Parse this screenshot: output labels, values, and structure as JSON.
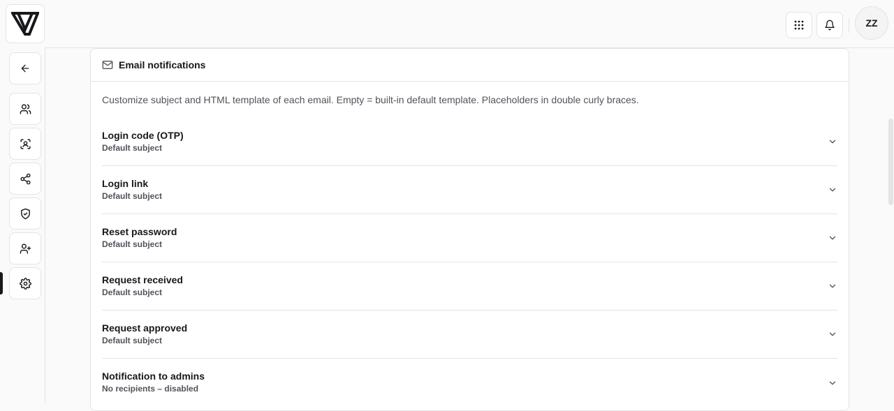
{
  "user": {
    "initials": "ZZ"
  },
  "card": {
    "title": "Email notifications",
    "description": "Customize subject and HTML template of each email. Empty = built-in default template. Placeholders in double curly braces."
  },
  "templates": [
    {
      "title": "Login code (OTP)",
      "subtitle": "Default subject"
    },
    {
      "title": "Login link",
      "subtitle": "Default subject"
    },
    {
      "title": "Reset password",
      "subtitle": "Default subject"
    },
    {
      "title": "Request received",
      "subtitle": "Default subject"
    },
    {
      "title": "Request approved",
      "subtitle": "Default subject"
    },
    {
      "title": "Notification to admins",
      "subtitle": "No recipients – disabled"
    }
  ],
  "sidebar": {
    "items": [
      {
        "icon": "back-arrow-icon"
      },
      {
        "icon": "users-icon"
      },
      {
        "icon": "face-scan-icon"
      },
      {
        "icon": "share-icon"
      },
      {
        "icon": "shield-check-icon"
      },
      {
        "icon": "user-plus-icon"
      },
      {
        "icon": "gear-icon",
        "active": true
      }
    ]
  },
  "colors": {
    "accent": "#18181b",
    "border": "#e4e4e7",
    "muted": "#52525b"
  }
}
